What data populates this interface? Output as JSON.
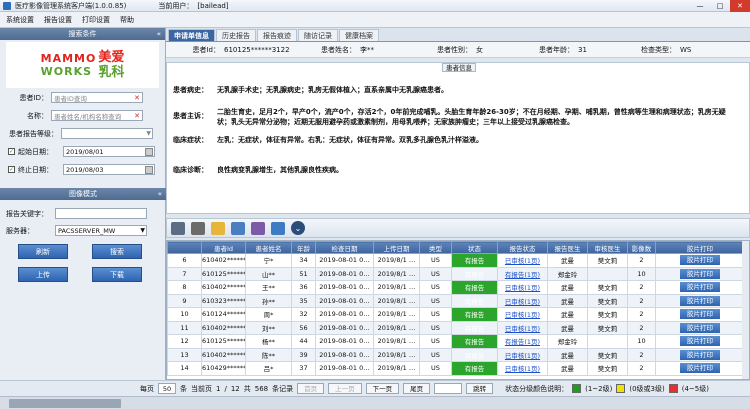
{
  "window": {
    "title": "医疗影像管理系统客户端(1.0.0.85)",
    "user_label": "当前用户：",
    "user": "[bailead]"
  },
  "menu": [
    "系统设置",
    "报告设置",
    "打印设置",
    "帮助"
  ],
  "left": {
    "search_header": "搜索条件",
    "logo_en1": "MAMMO",
    "logo_en2": "WORKS",
    "logo_cn1": "美爱",
    "logo_cn2": "乳科",
    "patient_id_label": "患者ID：",
    "patient_id_ph": "患者ID查询",
    "name_label": "名称：",
    "name_ph": "患者姓名/机构名称查询",
    "level_label": "患者报告等级：",
    "start_label": "起始日期：",
    "start_value": "2019/08/01",
    "end_label": "终止日期：",
    "end_value": "2019/08/03",
    "image_header": "图像模式",
    "keyword_label": "报告关键字：",
    "server_label": "服务器：",
    "server_value": "PACSSERVER_MW",
    "btn_refresh": "刷新",
    "btn_search": "搜索",
    "btn_upload": "上传",
    "btn_download": "下载"
  },
  "tabs": [
    "申请单信息",
    "历史报告",
    "报告痕迹",
    "随访记录",
    "健康档案"
  ],
  "patient": {
    "id_label": "患者Id：",
    "id": "610125******3122",
    "name_label": "患者姓名：",
    "name": "李**",
    "sex_label": "患者性别：",
    "sex": "女",
    "age_label": "患者年龄：",
    "age": "31",
    "type_label": "检查类型：",
    "type": "WS"
  },
  "report": {
    "title": "患者信息",
    "history_label": "患者病史：",
    "history": "无乳腺手术史；无乳腺病史；乳房无假体植入；直系亲属中无乳腺癌患者。",
    "complaint_label": "患者主诉：",
    "complaint": "二胎生育史，足月2个，早产0个，流产0个，存活2个，0年前完成哺乳。头胎生育年龄26-30岁；不在月经期、孕期、哺乳期，曾性病等生理和病理状态；乳房无疑状；乳头无异常分泌物；近期无服用避孕药或激素制剂，用母乳喂养；无家族肿瘤史；三年以上接受过乳腺癌检查。",
    "symptom_label": "临床症状：",
    "symptom": "左乳：无症状，体征有异常。右乳：无症状，体征有异常。双乳多孔腺色乳汁样溢液。",
    "diagnosis_label": "临床诊断：",
    "diagnosis": "良性病变乳腺增生，其他乳腺良性疾病。"
  },
  "grid": {
    "headers": [
      "",
      "患者Id",
      "患者姓名",
      "年龄",
      "检查日期",
      "上传日期",
      "类型",
      "状态",
      "报告状态",
      "报告医生",
      "审核医生",
      "影像数",
      "胶片打印"
    ],
    "rows": [
      [
        "6",
        "610402******",
        "宁*",
        "34",
        "2019-08-01 0…",
        "2019/8/1 …",
        "US",
        "有报告",
        "已审核(1页)",
        "武曼",
        "樊文莉",
        "2",
        "胶片打印"
      ],
      [
        "7",
        "610125******",
        "山**",
        "51",
        "2019-08-01 0…",
        "2019/8/1 …",
        "US",
        "有报告",
        "有报告(1页)",
        "郑金玲",
        "",
        "10",
        "胶片打印"
      ],
      [
        "8",
        "610402******",
        "王**",
        "36",
        "2019-08-01 0…",
        "2019/8/1 …",
        "US",
        "有报告",
        "已审核(1页)",
        "武曼",
        "樊文莉",
        "2",
        "胶片打印"
      ],
      [
        "9",
        "610323******",
        "孙**",
        "35",
        "2019-08-01 0…",
        "2019/8/1 …",
        "US",
        "有报告",
        "已审核(1页)",
        "武曼",
        "樊文莉",
        "2",
        "胶片打印"
      ],
      [
        "10",
        "610124******",
        "周*",
        "32",
        "2019-08-01 0…",
        "2019/8/1 …",
        "US",
        "有报告",
        "已审核(1页)",
        "武曼",
        "樊文莉",
        "2",
        "胶片打印"
      ],
      [
        "11",
        "610402******",
        "刘**",
        "56",
        "2019-08-01 0…",
        "2019/8/1 …",
        "US",
        "有报告",
        "已审核(1页)",
        "武曼",
        "樊文莉",
        "2",
        "胶片打印"
      ],
      [
        "12",
        "610125******",
        "杨**",
        "44",
        "2019-08-01 0…",
        "2019/8/1 …",
        "US",
        "有报告",
        "有报告(1页)",
        "郑金玲",
        "",
        "10",
        "胶片打印"
      ],
      [
        "13",
        "610402******",
        "陈**",
        "39",
        "2019-08-01 0…",
        "2019/8/1 …",
        "US",
        "有报告",
        "已审核(1页)",
        "武曼",
        "樊文莉",
        "2",
        "胶片打印"
      ],
      [
        "14",
        "610429******",
        "吕*",
        "37",
        "2019-08-01 0…",
        "2019/8/1 …",
        "US",
        "有报告",
        "已审核(1页)",
        "武曼",
        "樊文莉",
        "2",
        "胶片打印"
      ]
    ]
  },
  "pager": {
    "per_page_label": "每页",
    "per_page": "50",
    "per_page_unit": "条",
    "cur_label": "当前页",
    "cur": "1",
    "sep": "/",
    "total_pages": "12",
    "total_label": "共",
    "total": "568",
    "total_unit": "条记录",
    "first": "首页",
    "prev": "上一页",
    "next": "下一页",
    "last": "尾页",
    "jump": "跳转",
    "legend_label": "状态分级颜色说明：",
    "legend1": "(1~2级)",
    "legend2": "(0级或3级)",
    "legend3": "(4~5级)",
    "color1": "#1aa01a",
    "color2": "#f2e200",
    "color3": "#e53030"
  }
}
